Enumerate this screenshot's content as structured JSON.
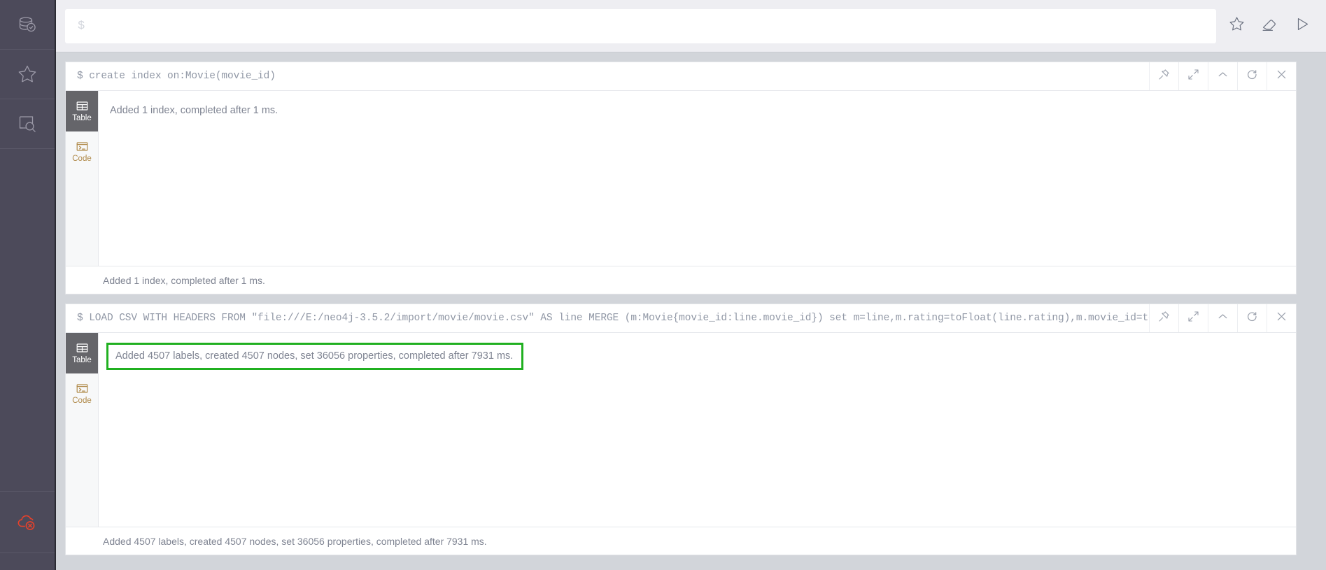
{
  "sidebar": {
    "items": [
      {
        "name": "database-check-icon",
        "label": "Database Information"
      },
      {
        "name": "star-icon",
        "label": "Favorites"
      },
      {
        "name": "document-search-icon",
        "label": "Documents"
      }
    ],
    "bottom": {
      "name": "cloud-disconnected-icon",
      "label": "Disconnected",
      "color": "#e8412a"
    },
    "background": "#4c4a5a"
  },
  "editor": {
    "prompt": "$",
    "value": "",
    "placeholder": "$",
    "actions": [
      {
        "name": "favorite-star-icon",
        "label": "Add to Favorites"
      },
      {
        "name": "eraser-icon",
        "label": "Clear"
      },
      {
        "name": "run-play-icon",
        "label": "Run"
      }
    ]
  },
  "card_tools": [
    {
      "name": "pin-icon",
      "label": "Pin"
    },
    {
      "name": "expand-icon",
      "label": "Expand"
    },
    {
      "name": "collapse-chevron-up-icon",
      "label": "Collapse"
    },
    {
      "name": "refresh-icon",
      "label": "Rerun"
    },
    {
      "name": "close-icon",
      "label": "Close"
    }
  ],
  "view_tabs": [
    {
      "name": "table-tab",
      "label": "Table",
      "icon": "table-icon"
    },
    {
      "name": "code-tab",
      "label": "Code",
      "icon": "code-terminal-icon"
    }
  ],
  "cards": [
    {
      "query": "$ create index on:Movie(movie_id)",
      "active_tab": "Table",
      "result": "Added 1 index, completed after 1 ms.",
      "footer": "Added 1 index, completed after 1 ms.",
      "highlighted": false
    },
    {
      "query": "$ LOAD CSV WITH HEADERS FROM \"file:///E:/neo4j-3.5.2/import/movie/movie.csv\" AS line  MERGE (m:Movie{movie_id:line.movie_id}) set m=line,m.rating=toFloat(line.rating),m.movie_id=toInteger(line.movi…",
      "active_tab": "Table",
      "result": "Added 4507 labels, created 4507 nodes, set 36056 properties, completed after 7931 ms.",
      "footer": "Added 4507 labels, created 4507 nodes, set 36056 properties, completed after 7931 ms.",
      "highlighted": true,
      "highlight_color": "#20b020"
    }
  ]
}
